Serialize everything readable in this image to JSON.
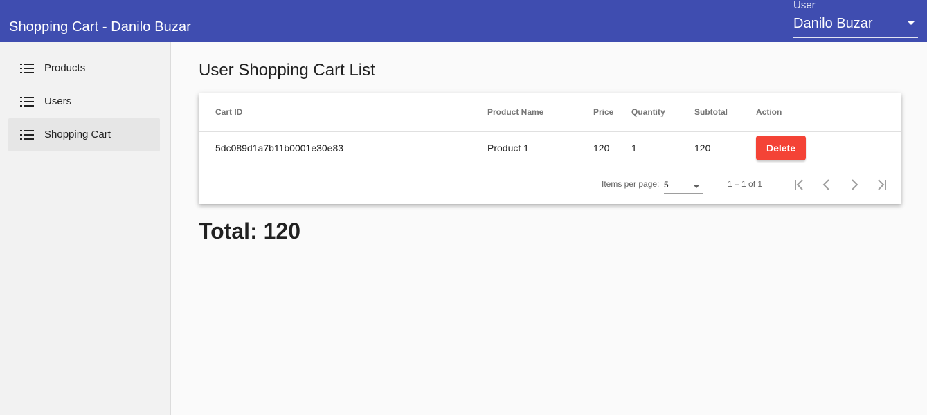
{
  "header": {
    "title": "Shopping Cart - Danilo Buzar",
    "user_select": {
      "label": "User",
      "value": "Danilo Buzar"
    }
  },
  "sidebar": {
    "items": [
      {
        "label": "Products",
        "icon": "list-icon"
      },
      {
        "label": "Users",
        "icon": "list-icon"
      },
      {
        "label": "Shopping Cart",
        "icon": "list-icon",
        "active": true
      }
    ]
  },
  "main": {
    "title": "User Shopping Cart List",
    "table": {
      "columns": [
        "Cart ID",
        "Product Name",
        "Price",
        "Quantity",
        "Subtotal",
        "Action"
      ],
      "rows": [
        {
          "cart_id": "5dc089d1a7b11b0001e30e83",
          "product_name": "Product 1",
          "price": "120",
          "quantity": "1",
          "subtotal": "120",
          "action_label": "Delete"
        }
      ]
    },
    "paginator": {
      "items_per_page_label": "Items per page:",
      "items_per_page": "5",
      "range": "1 – 1 of 1"
    },
    "total": "Total: 120"
  },
  "colors": {
    "toolbar": "#3f4db0",
    "delete": "#f44336",
    "sidebar_bg": "#f2f2f2",
    "sidebar_active": "#e6e6e6"
  }
}
